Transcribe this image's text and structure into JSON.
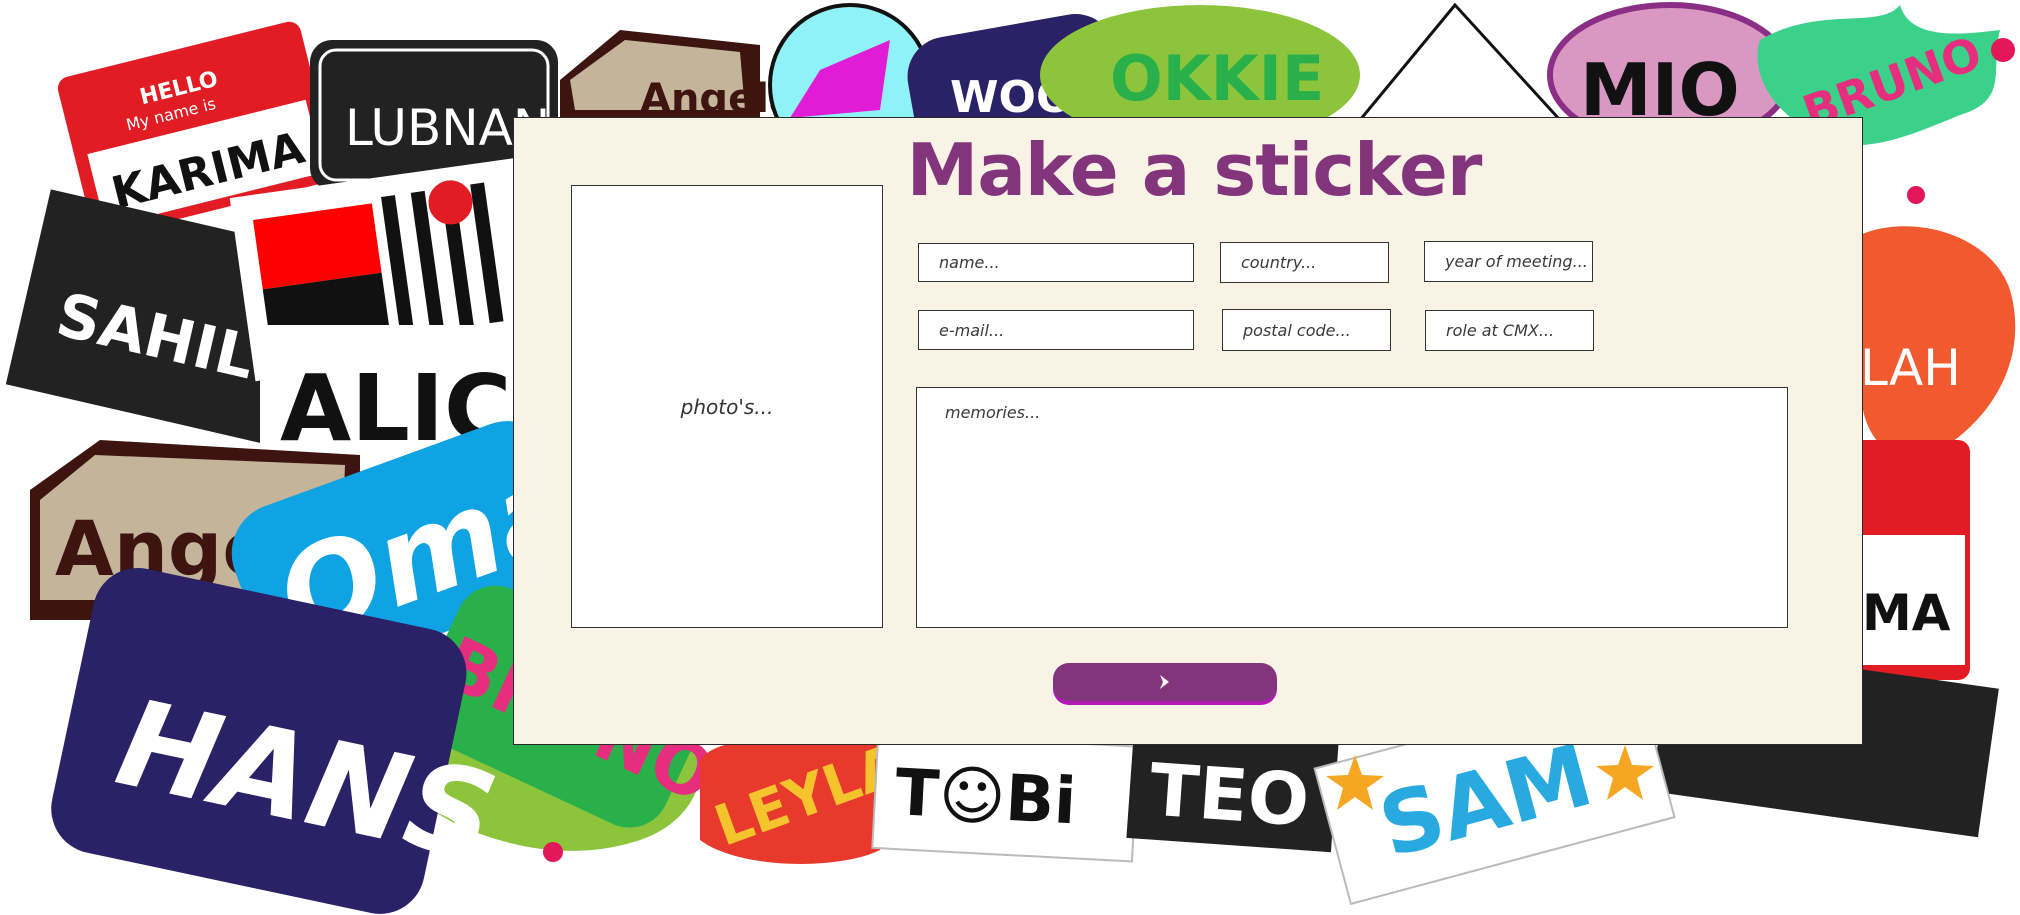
{
  "background": {
    "stickers": [
      {
        "id": "hello",
        "header": "HELLO",
        "sub": "My name is",
        "name": "KARIMA"
      },
      {
        "id": "lubnan",
        "name": "LUBNAN"
      },
      {
        "id": "angela-top",
        "name": "Angela"
      },
      {
        "id": "sahil",
        "name": "SAHIL"
      },
      {
        "id": "alice",
        "name": "ALICE"
      },
      {
        "id": "angel",
        "name": "Angel"
      },
      {
        "id": "omar",
        "name": "Omar"
      },
      {
        "id": "hans",
        "name": "HANS"
      },
      {
        "id": "bruno-left",
        "name": "BRUNO"
      },
      {
        "id": "leyla",
        "name": "LEYLA"
      },
      {
        "id": "tobi",
        "name": "T☺Bi"
      },
      {
        "id": "teo",
        "name": "TEO"
      },
      {
        "id": "sam",
        "name": "SAM"
      },
      {
        "id": "okki",
        "name": "OKKIE"
      },
      {
        "id": "mio",
        "name": "MIO"
      },
      {
        "id": "bruno-right",
        "name": "BRUNO"
      },
      {
        "id": "lah",
        "name": "LAH"
      },
      {
        "id": "ma",
        "name": "MA"
      },
      {
        "id": "woo",
        "name": "WOO"
      }
    ],
    "colors": {
      "purple": "#83357c",
      "cream": "#f9f3e6",
      "accent": "#b21ab5"
    }
  },
  "form": {
    "title": "Make a sticker",
    "photo_label": "photo's...",
    "fields": {
      "name": "name...",
      "country": "country...",
      "year": "year of meeting...",
      "email": "e-mail...",
      "postal": "postal code...",
      "role": "role at CMX..."
    },
    "memories_placeholder": "memories...",
    "submit_icon": "chevron-right-icon"
  }
}
